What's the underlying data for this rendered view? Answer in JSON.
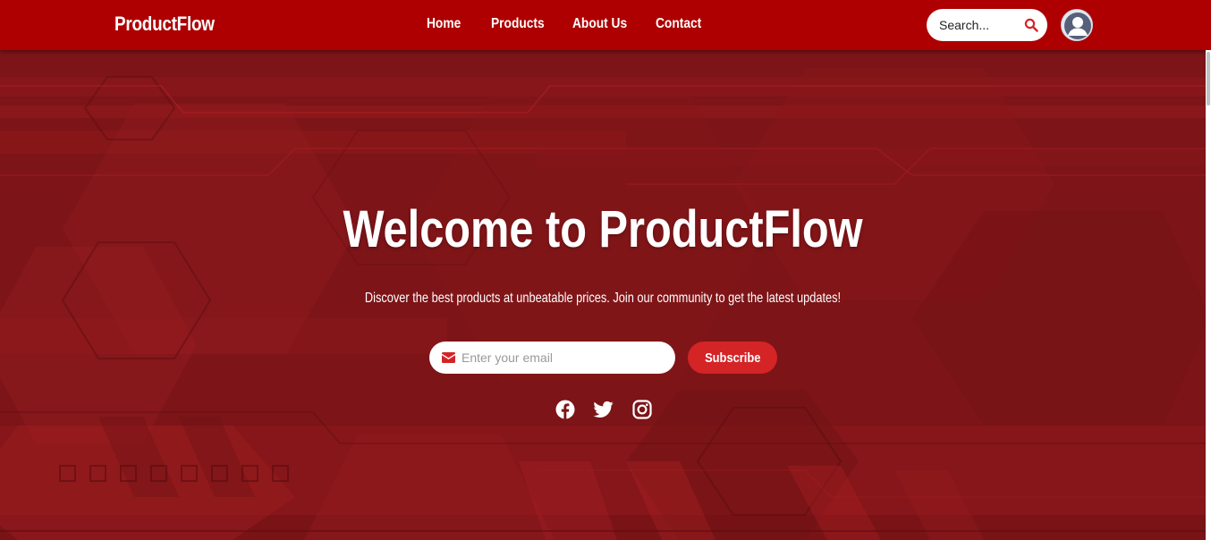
{
  "navbar": {
    "brand": "ProductFlow",
    "links": [
      {
        "label": "Home"
      },
      {
        "label": "Products"
      },
      {
        "label": "About Us"
      },
      {
        "label": "Contact"
      }
    ],
    "search": {
      "placeholder": "Search...",
      "icon": "search-icon"
    },
    "avatar": {
      "icon": "user-avatar-icon"
    }
  },
  "hero": {
    "title": "Welcome to ProductFlow",
    "subtitle": "Discover the best products at unbeatable prices. Join our community to get the latest updates!",
    "email": {
      "placeholder": "Enter your email",
      "icon": "envelope-icon"
    },
    "subscribe_label": "Subscribe",
    "social": [
      {
        "icon": "facebook-icon"
      },
      {
        "icon": "twitter-icon"
      },
      {
        "icon": "instagram-icon"
      }
    ]
  },
  "colors": {
    "nav_bg": "#ae0000",
    "hero_bg": "#7e1418",
    "accent": "#d42426",
    "text": "#ffffff"
  }
}
